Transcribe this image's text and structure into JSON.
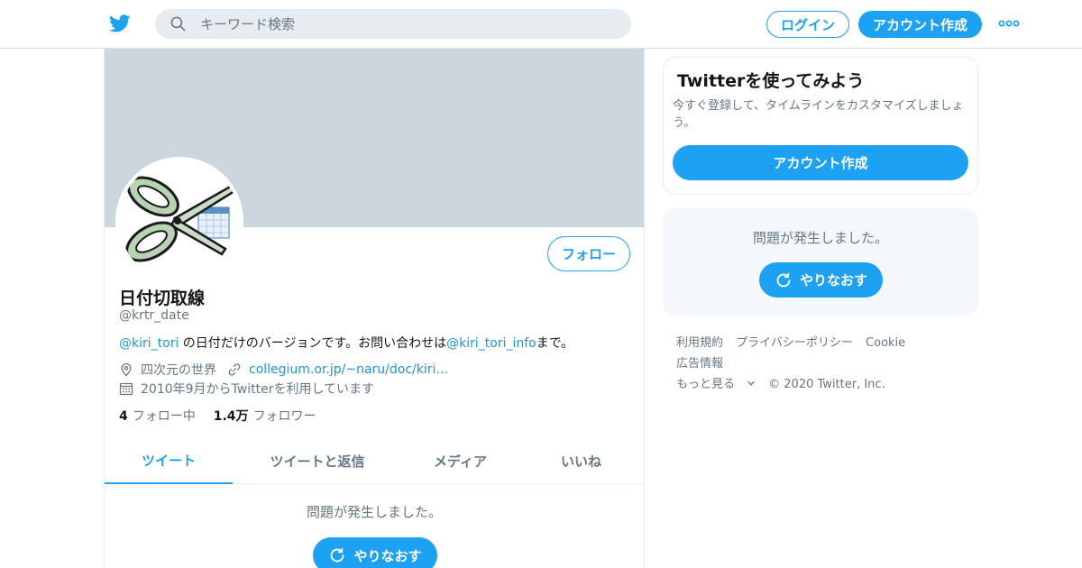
{
  "header": {
    "search_placeholder": "キーワード検索",
    "login_label": "ログイン",
    "signup_label": "アカウント作成"
  },
  "profile": {
    "display_name": "日付切取線",
    "handle": "@krtr_date",
    "bio": {
      "mention1": "@kiri_tori",
      "text1": " の日付だけのバージョンです。お問い合わせは",
      "mention2": "@kiri_tori_info",
      "text2": "まで。"
    },
    "location": "四次元の世界",
    "url": "collegium.or.jp/~naru/doc/kiri…",
    "joined": "2010年9月からTwitterを利用しています",
    "following_count": "4",
    "following_label": "フォロー中",
    "followers_count": "1.4万",
    "followers_label": "フォロワー",
    "follow_button": "フォロー"
  },
  "tabs": [
    {
      "label": "ツイート",
      "active": true
    },
    {
      "label": "ツイートと返信",
      "active": false
    },
    {
      "label": "メディア",
      "active": false
    },
    {
      "label": "いいね",
      "active": false
    }
  ],
  "timeline": {
    "error_text": "問題が発生しました。",
    "retry_label": "やりなおす"
  },
  "sidebar": {
    "signup_card": {
      "title": "Twitterを使ってみよう",
      "description": "今すぐ登録して、タイムラインをカスタマイズしましょう。",
      "button": "アカウント作成"
    },
    "error_card": {
      "text": "問題が発生しました。",
      "retry_label": "やりなおす"
    },
    "footer": {
      "links": [
        "利用規約",
        "プライバシーポリシー",
        "Cookie",
        "広告情報"
      ],
      "more": "もっと見る",
      "copyright": "© 2020 Twitter, Inc."
    }
  },
  "colors": {
    "accent": "#1da1f2",
    "link": "#1b95e0",
    "secondary_text": "#657786",
    "banner": "#ccd6dd"
  },
  "icons": [
    "twitter-bird-icon",
    "search-icon",
    "more-icon",
    "location-icon",
    "link-icon",
    "calendar-icon",
    "refresh-icon",
    "chevron-down-icon"
  ]
}
